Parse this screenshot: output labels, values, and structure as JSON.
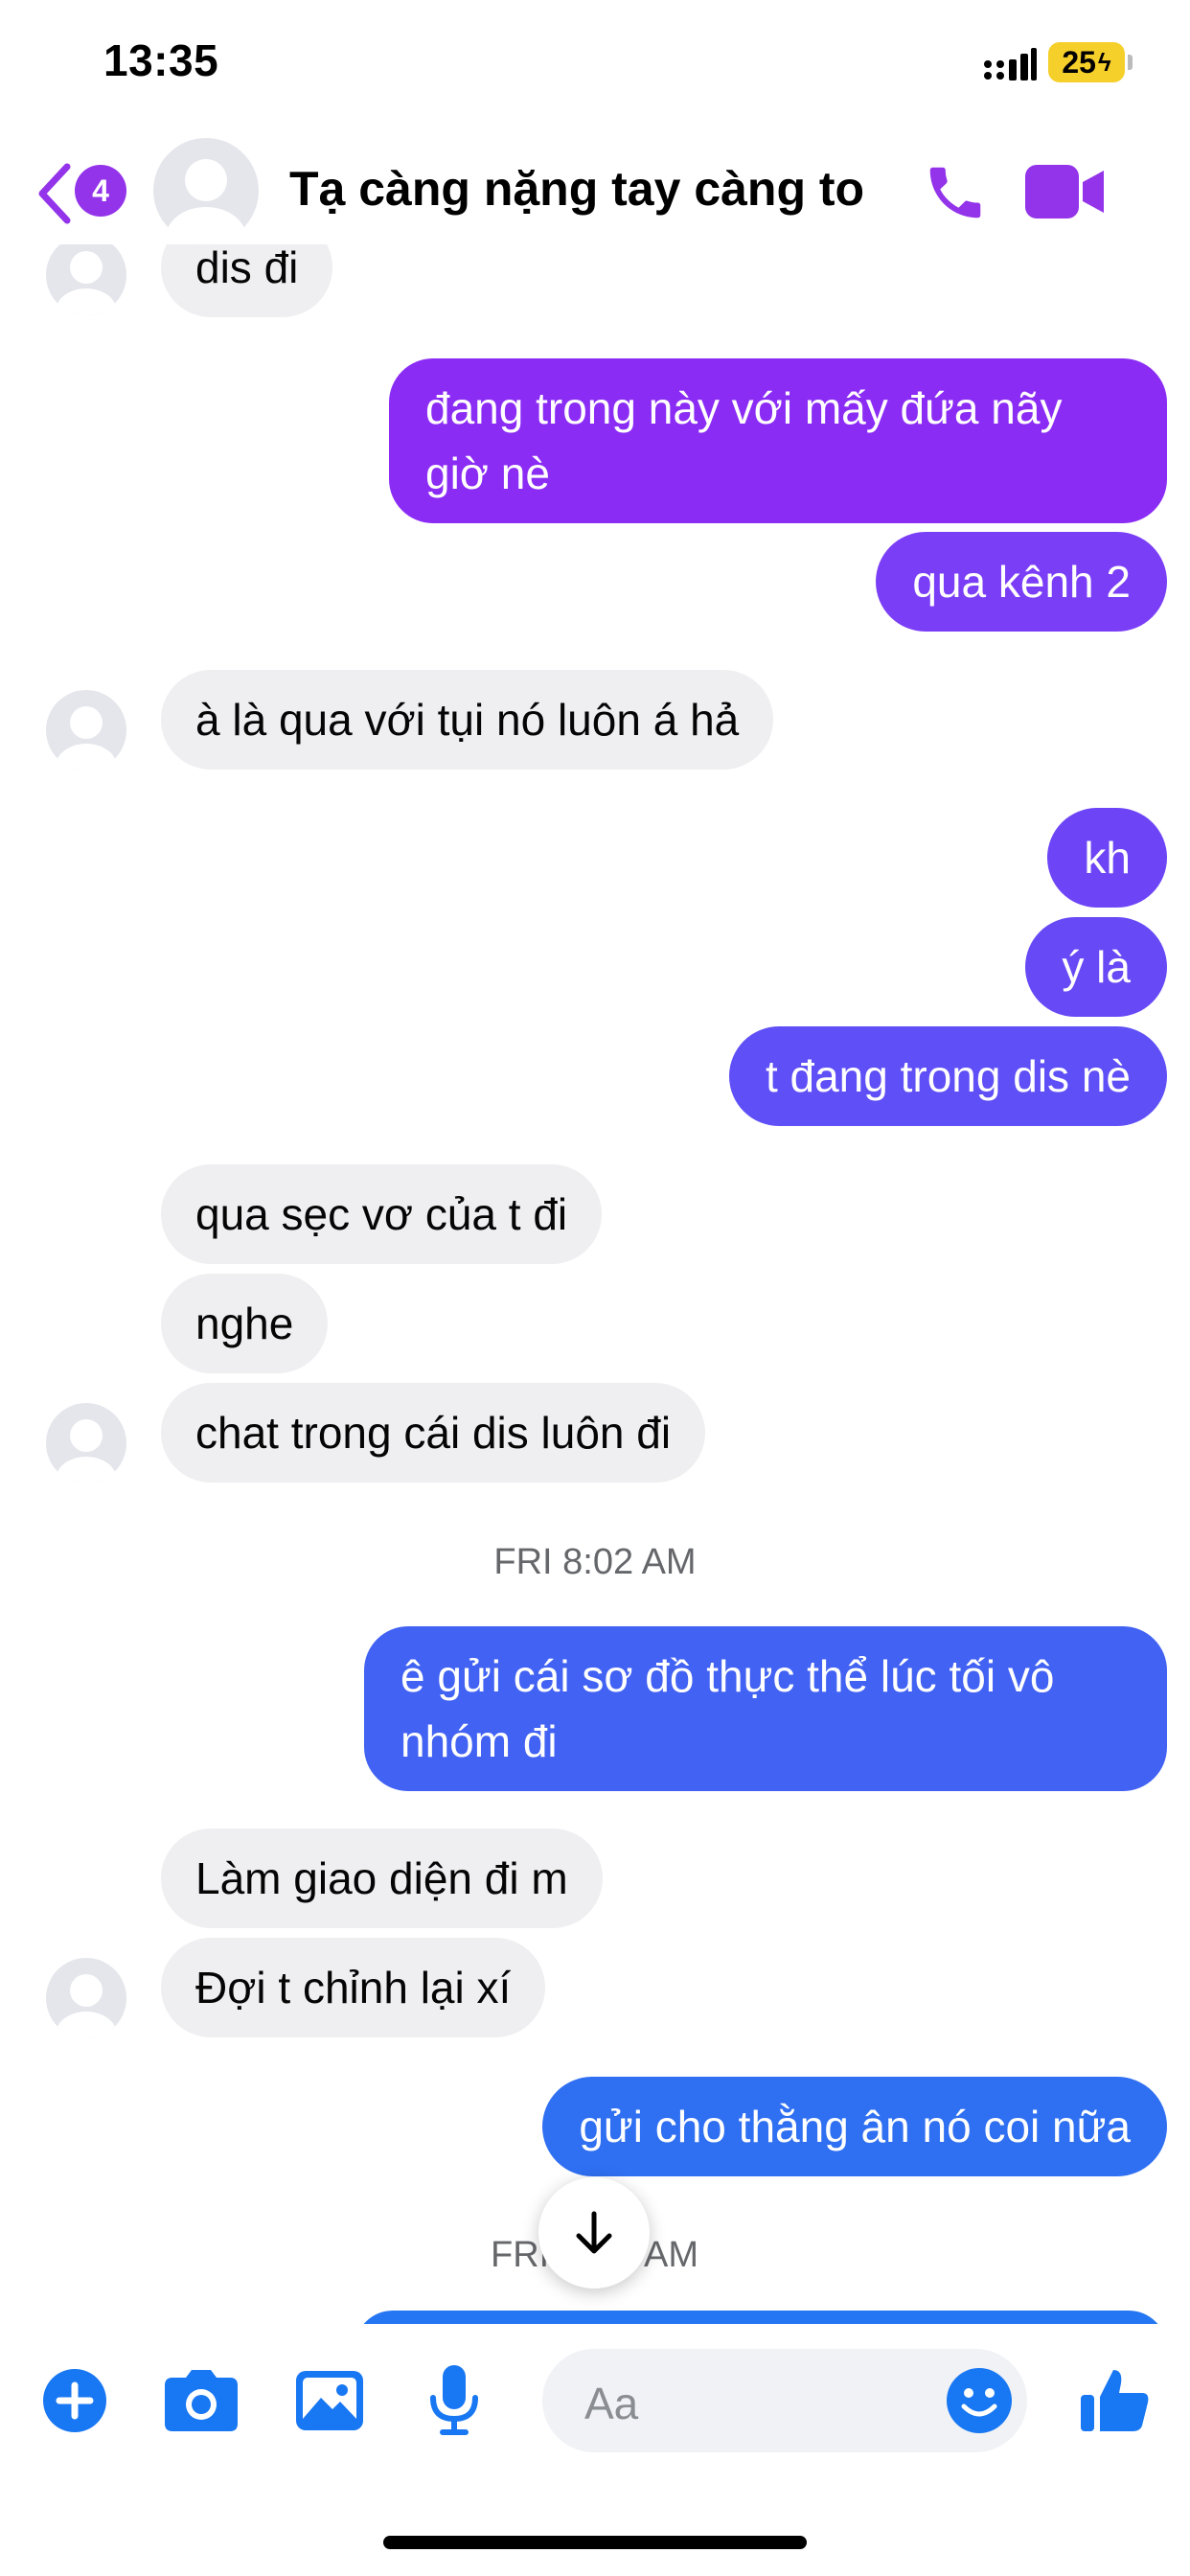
{
  "status_bar": {
    "time": "13:35",
    "battery": "25"
  },
  "header": {
    "unread_count": "4",
    "title": "Tạ càng nặng tay càng to"
  },
  "messages": [
    {
      "text": "dis đi"
    },
    {
      "text": "đang trong này với mấy đứa nãy giờ nè"
    },
    {
      "text": "qua kênh 2"
    },
    {
      "text": "à là qua với tụi nó luôn á hả"
    },
    {
      "text": "kh"
    },
    {
      "text": "ý là"
    },
    {
      "text": "t đang trong dis nè"
    },
    {
      "text": "qua sẹc vơ của t đi"
    },
    {
      "text": "nghe"
    },
    {
      "text": "chat trong cái dis luôn đi"
    },
    {
      "text": "ê gửi cái sơ đồ thực thể lúc tối vô nhóm đi"
    },
    {
      "text": "Làm giao diện đi m"
    },
    {
      "text": "Đợi t chỉnh lại xí"
    },
    {
      "text": "gửi cho thằng ân nó coi nữa"
    }
  ],
  "timestamps": {
    "first": "FRI 8:02 AM",
    "second_partial_left": "FRI",
    "second_partial_right": "AM"
  },
  "composer": {
    "placeholder": "Aa"
  },
  "colors": {
    "accent_purple": "#9333ea",
    "bubble_in": "#efeff1",
    "messenger_blue": "#1877f2"
  }
}
